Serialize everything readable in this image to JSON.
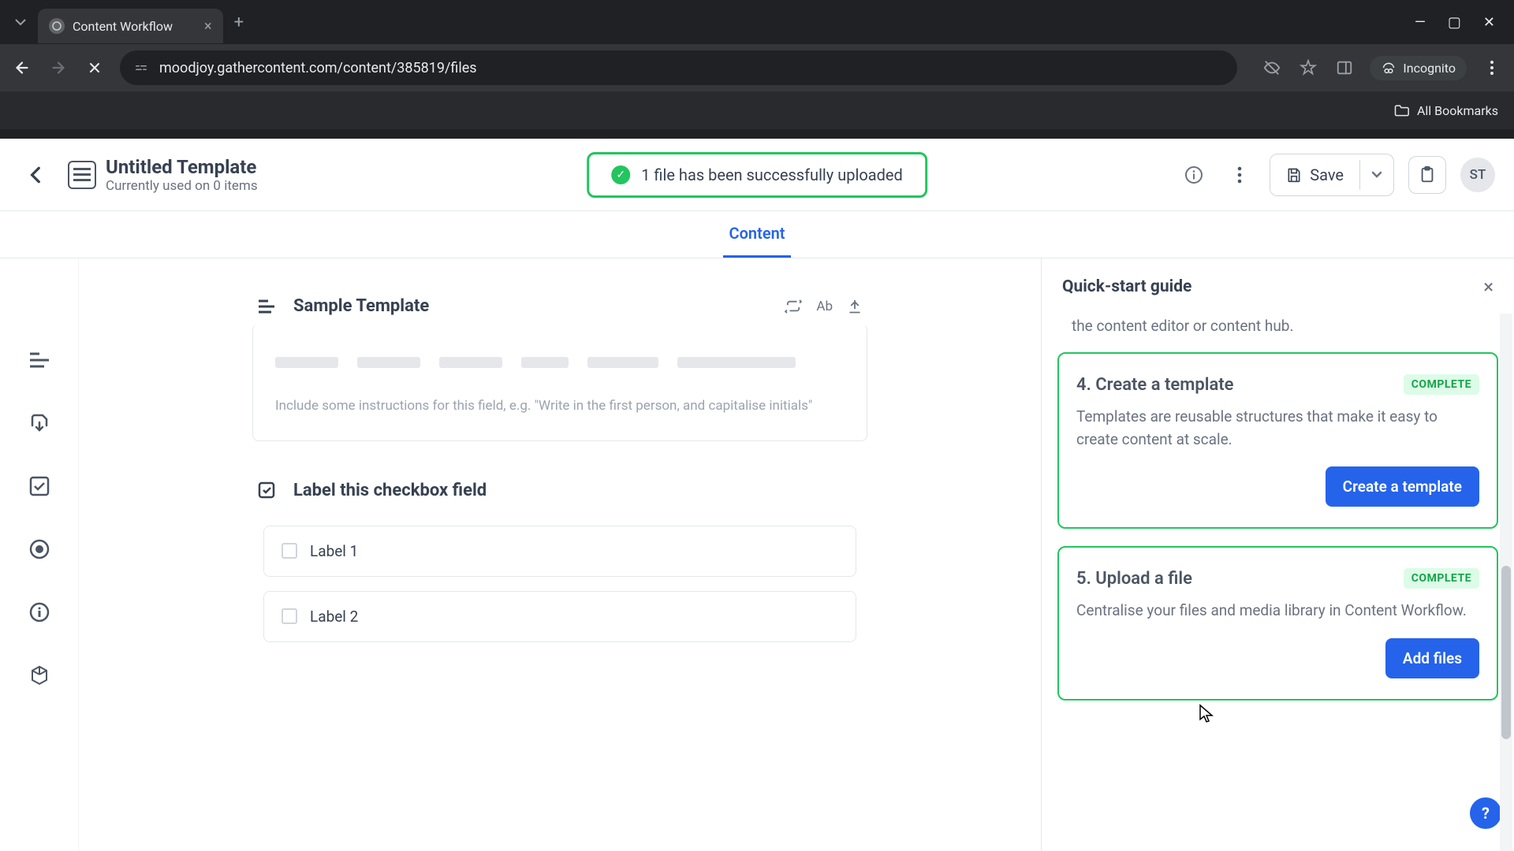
{
  "browser": {
    "tab_title": "Content Workflow",
    "url": "moodjoy.gathercontent.com/content/385819/files",
    "incognito_label": "Incognito",
    "bookmarks_label": "All Bookmarks"
  },
  "header": {
    "title": "Untitled Template",
    "subtitle": "Currently used on 0 items",
    "toast": "1 file has been successfully uploaded",
    "save_label": "Save",
    "avatar_initials": "ST"
  },
  "content_nav": {
    "active": "Content"
  },
  "editor": {
    "text_field": {
      "title": "Sample Template",
      "ab_label": "Ab",
      "instructions_placeholder": "Include some instructions for this field, e.g. \"Write in the first person, and capitalise initials\""
    },
    "checkbox_field": {
      "title": "Label this checkbox field",
      "options": [
        "Label 1",
        "Label 2"
      ]
    }
  },
  "sidebar": {
    "title": "Quick-start guide",
    "partial_line": "the content editor or content hub.",
    "steps": [
      {
        "title": "4. Create a template",
        "badge": "COMPLETE",
        "desc": "Templates are reusable structures that make it easy to create content at scale.",
        "cta": "Create a template"
      },
      {
        "title": "5. Upload a file",
        "badge": "COMPLETE",
        "desc": "Centralise your files and media library in Content Workflow.",
        "cta": "Add files"
      }
    ],
    "help_label": "?"
  }
}
